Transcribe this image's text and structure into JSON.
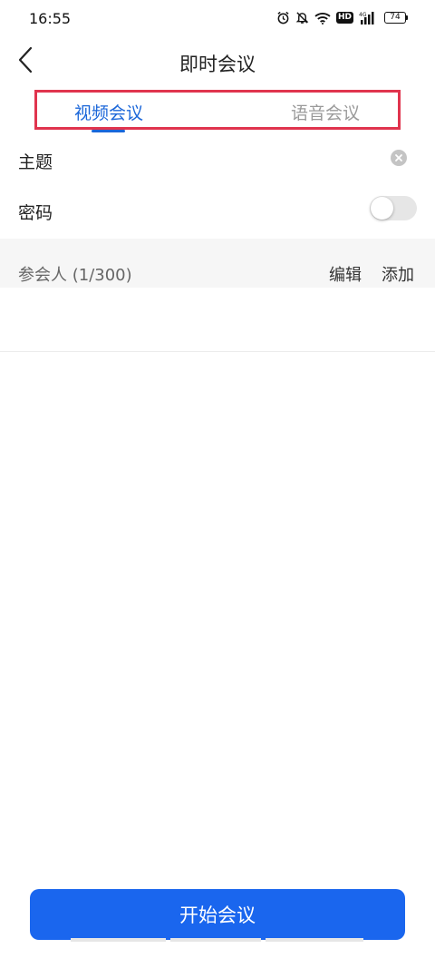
{
  "status_bar": {
    "time": "16:55",
    "network": "4G",
    "hd_badge": "HD",
    "battery": "74",
    "icons": [
      "alarm-icon",
      "mute-icon",
      "wifi-icon",
      "hd-icon",
      "signal-icon",
      "battery-icon"
    ]
  },
  "header": {
    "title": "即时会议",
    "back_icon": "chevron-left-icon"
  },
  "tabs": [
    {
      "label": "视频会议",
      "active": true
    },
    {
      "label": "语音会议",
      "active": false
    }
  ],
  "form": {
    "subject_label": "主题",
    "subject_clear_icon": "clear-icon",
    "password_label": "密码",
    "password_enabled": false
  },
  "participants": {
    "label": "参会人 (1/300)",
    "edit_label": "编辑",
    "add_label": "添加"
  },
  "start_button_label": "开始会议",
  "colors": {
    "accent": "#1a66ee",
    "tab_active": "#1a66d9",
    "tab_inactive": "#9a9a9a",
    "highlight_box": "#e0344e"
  }
}
